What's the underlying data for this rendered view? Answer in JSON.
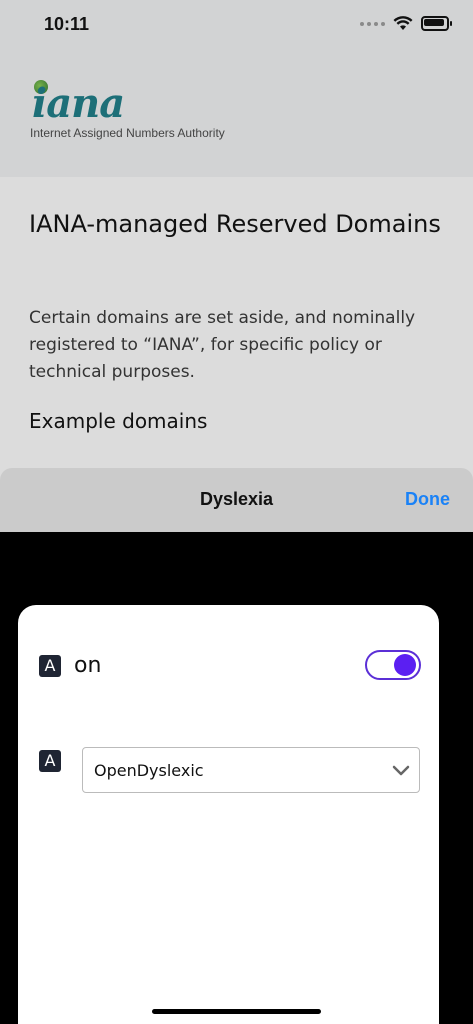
{
  "status_bar": {
    "time": "10:11"
  },
  "header": {
    "logo_text": "iana",
    "logo_subtitle": "Internet Assigned Numbers Authority"
  },
  "content": {
    "title": "IANA-managed Reserved Domains",
    "description": "Certain domains are set aside, and nominally registered to “IANA”, for specific policy or technical purposes.",
    "section_heading": "Example domains"
  },
  "sheet": {
    "title": "Dyslexia",
    "done_label": "Done"
  },
  "panel": {
    "toggle_label": "on",
    "toggle_on": true,
    "font_select_value": "OpenDyslexic",
    "icon_glyph": "A"
  },
  "colors": {
    "accent": "#5b1ff2",
    "done_blue": "#1a82f7",
    "logo_teal": "#1d6f78"
  }
}
